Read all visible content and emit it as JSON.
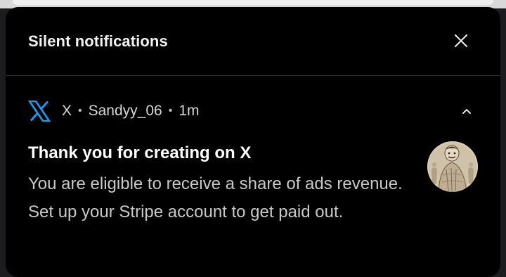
{
  "header": {
    "title": "Silent notifications",
    "close_icon": "close-icon"
  },
  "notification": {
    "app_icon": "x-logo-icon",
    "app_name": "X",
    "account": "Sandyy_06",
    "time": "1m",
    "separator": "•",
    "expand_icon": "chevron-up-icon",
    "title": "Thank you for creating on X",
    "body": "You are eligible to receive a share of ads revenue. Set up your Stripe account to get paid out.",
    "avatar": "profile-avatar"
  },
  "colors": {
    "panel_background": "#000000",
    "title_text": "#f2f2f2",
    "body_text": "#c8c8c8",
    "x_logo_blue": "#1d9bf0"
  }
}
